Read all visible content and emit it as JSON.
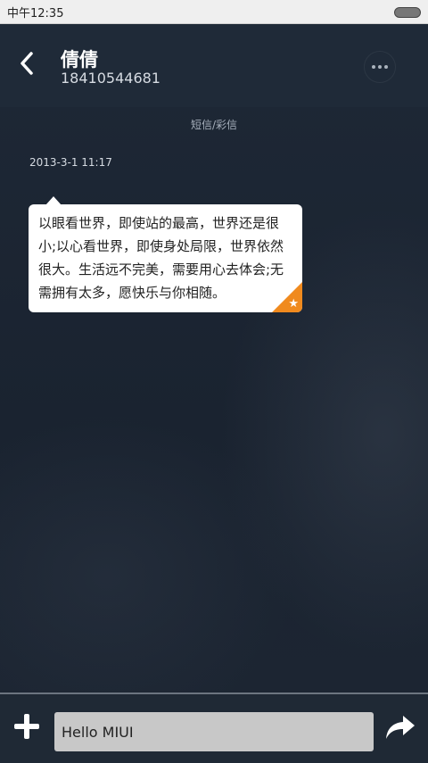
{
  "status_bar": {
    "time": "中午12:35"
  },
  "header": {
    "contact_name": "倩倩",
    "contact_number": "18410544681"
  },
  "conversation": {
    "type_label": "短信/彩信",
    "messages": [
      {
        "timestamp": "2013-3-1 11:17",
        "text": "以眼看世界，即使站的最高，世界还是很小;以心看世界，即使身处局限，世界依然很大。生活远不完美，需要用心去体会;无需拥有太多，愿快乐与你相随。",
        "starred": true
      }
    ]
  },
  "composer": {
    "input_value": "Hello MIUI"
  },
  "icons": {
    "back": "chevron-left-icon",
    "more": "more-dots-icon",
    "star": "star-icon",
    "add": "plus-icon",
    "send": "send-arrow-icon"
  },
  "colors": {
    "accent_star": "#f08a1e",
    "background": "#1c2633",
    "bubble": "#ffffff"
  }
}
